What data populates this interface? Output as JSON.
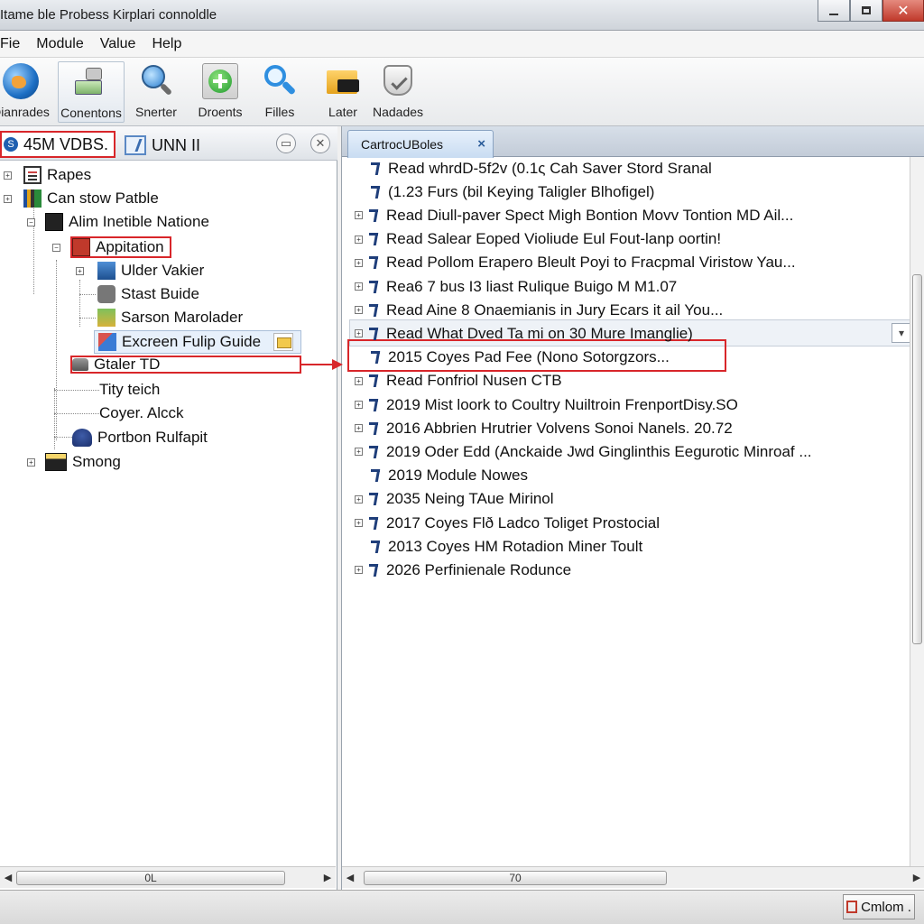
{
  "window": {
    "title": "Itame ble Probess Kirplari connoldle",
    "min_glyph": "–",
    "max_glyph": "□",
    "close_glyph": "✕"
  },
  "menu": {
    "items": [
      "Fie",
      "Module",
      "Value",
      "Help"
    ]
  },
  "toolbar": {
    "items": [
      {
        "label": "Dianrades",
        "icon": "globe-icon"
      },
      {
        "label": "Conentons",
        "icon": "connection-icon"
      },
      {
        "label": "Snerter",
        "icon": "search-globe-icon"
      },
      {
        "label": "Droents",
        "icon": "add-icon"
      },
      {
        "label": "Filles",
        "icon": "search-icon"
      },
      {
        "label": "Later",
        "icon": "folder-icon"
      },
      {
        "label": "Nadades",
        "icon": "badge-icon"
      }
    ]
  },
  "left_pane": {
    "tab1_label": "45M VDBS.",
    "tab2_label": "UNN II",
    "tree": [
      "Rapes",
      "Can stow Patble",
      "Alim Inetible Natione",
      "Appitation",
      "Ulder Vakier",
      "Stast Buide",
      "Sarson Marolader",
      "Excreen Fulip Guide",
      "Gtaler TD",
      "Tity teich",
      "Coyer. Alcck",
      "Portbon Rulfapit",
      "Smong"
    ],
    "scroll_label": "0L"
  },
  "right_pane": {
    "tab_label": "CartrocUBoles",
    "tab_close": "×",
    "rows": [
      "Read whrdD-5f2v (0.1ς Cah Saver Stord Sranal",
      "(1.23 Furs (bil Keying Taligler Blhofigel)",
      "Read Diull-paver Spect Migh Bontion Movv Tontion MD Ail...",
      "Read Salear Eoped Violiude Eul Fout-lanp oortin!",
      "Read Pollom Erapero Bleult Poyi to Fracpmal Viristow Yau...",
      "Rea6 7 bus I3 liast Rulique Buigo M M1.07",
      "Read Aine 8 Onaemianis in Jury Ecars it ail You...",
      "Read What Dved Ta mi on 30 Mure Imanglie)",
      "2015 Coyes Pad Fee (Nono Sotorgzors...",
      "Read Fonfriol Nusen CTB",
      "2019 Mist loork to Coultry Nuiltroin FrenportDisy.SO",
      "2016 Abbrien Hrutrier Volvens Sonoi Nanels. 20.72",
      "2019 Oder Edd (Anckaide Jwd Ginglinthis Eegurotic Minroaf ...",
      "2019 Module Nowes",
      "2035 Neing TAue Mirinol",
      "2017 Coyes Flð Ladco Toliget Prostocial",
      "2013 Coyes HM Rotadion Miner Toult",
      "2026 Perfinienale Rodunce"
    ],
    "scroll_label": "70"
  },
  "status": {
    "button_label": "Cmlom ."
  },
  "colors": {
    "highlight_red": "#d8262a"
  }
}
